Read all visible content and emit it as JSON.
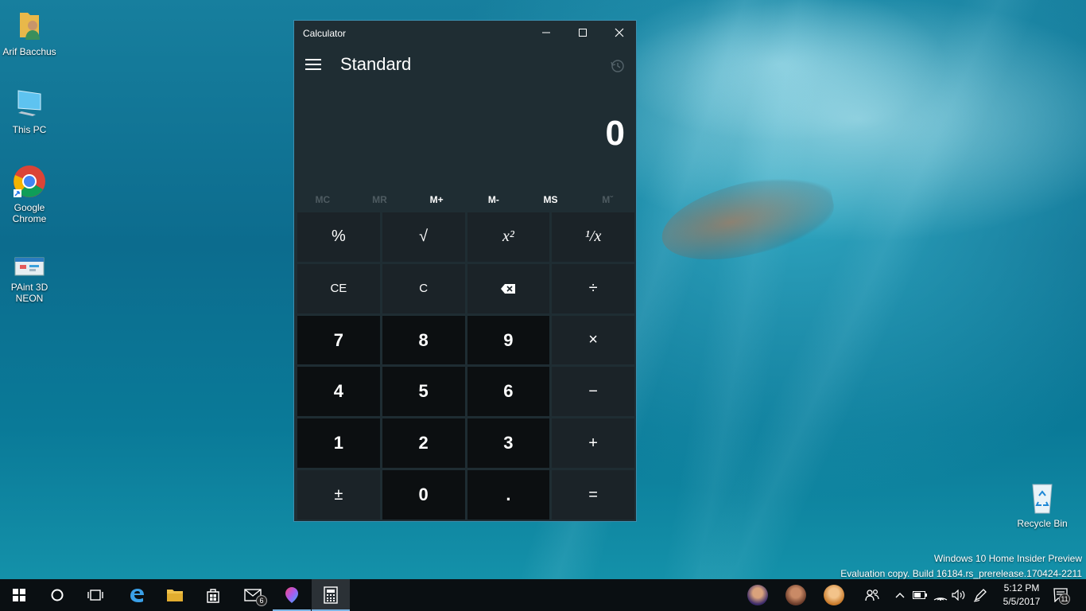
{
  "desktop": {
    "icons": [
      {
        "label": "Arif Bacchus"
      },
      {
        "label": "This PC"
      },
      {
        "label": "Google Chrome"
      },
      {
        "label": "PAint 3D NEON"
      },
      {
        "label": "Recycle Bin"
      }
    ],
    "watermark": {
      "line1": "Windows 10 Home Insider Preview",
      "line2": "Evaluation copy. Build 16184.rs_prerelease.170424-2211"
    }
  },
  "calculator": {
    "window_title": "Calculator",
    "mode": "Standard",
    "display_value": "0",
    "memory": [
      "MC",
      "MR",
      "M+",
      "M-",
      "MS",
      "Mˇ"
    ],
    "keys": [
      {
        "label": "%",
        "kind": "op"
      },
      {
        "label": "√",
        "kind": "op"
      },
      {
        "label": "x²",
        "kind": "op"
      },
      {
        "label": "¹/x",
        "kind": "op"
      },
      {
        "label": "CE",
        "kind": "op"
      },
      {
        "label": "C",
        "kind": "op"
      },
      {
        "label": "⌫",
        "kind": "op"
      },
      {
        "label": "÷",
        "kind": "op"
      },
      {
        "label": "7",
        "kind": "num"
      },
      {
        "label": "8",
        "kind": "num"
      },
      {
        "label": "9",
        "kind": "num"
      },
      {
        "label": "×",
        "kind": "op"
      },
      {
        "label": "4",
        "kind": "num"
      },
      {
        "label": "5",
        "kind": "num"
      },
      {
        "label": "6",
        "kind": "num"
      },
      {
        "label": "−",
        "kind": "op"
      },
      {
        "label": "1",
        "kind": "num"
      },
      {
        "label": "2",
        "kind": "num"
      },
      {
        "label": "3",
        "kind": "num"
      },
      {
        "label": "+",
        "kind": "op"
      },
      {
        "label": "±",
        "kind": "op"
      },
      {
        "label": "0",
        "kind": "num"
      },
      {
        "label": ".",
        "kind": "num"
      },
      {
        "label": "=",
        "kind": "op"
      }
    ]
  },
  "taskbar": {
    "mail_badge": "6",
    "time": "5:12 PM",
    "date": "5/5/2017",
    "notification_count": "11"
  },
  "colors": {
    "accent": "#3b8fb0",
    "calc_bg": "#1f2d33",
    "num_key": "#0c0f11",
    "op_key": "#1b2328"
  }
}
